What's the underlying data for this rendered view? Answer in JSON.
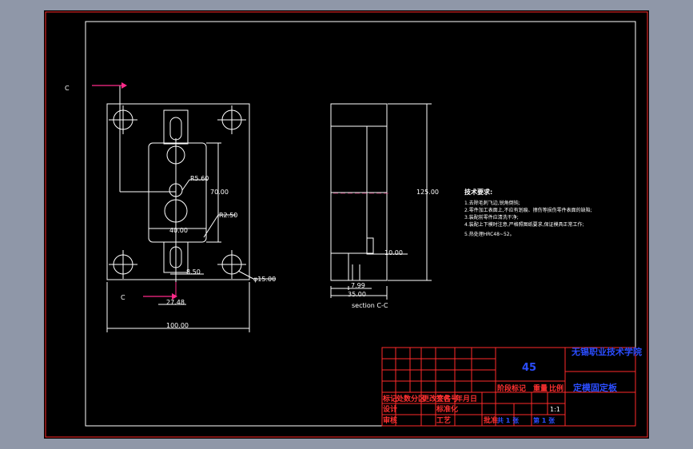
{
  "drawing": {
    "front_view": {
      "section_label_top": "C",
      "section_label_bottom": "C",
      "dims": {
        "r5_60": "R5.60",
        "d70_00": "70.00",
        "r2_50": "R2.50",
        "d40_00": "40.00",
        "d8_50": "8.50",
        "phi15_00": "φ15.00",
        "d27_48": "27.48",
        "d100_00": "100.00"
      }
    },
    "section_view": {
      "dims": {
        "d125_00": "125.00",
        "d10_00": "10.00",
        "d7_99": "7.99",
        "d35_00": "35.00"
      },
      "caption": "section C-C"
    },
    "notes": {
      "title": "技术要求:",
      "lines": [
        "1.去除毛刺飞边,锐角倒钝;",
        "2.零件加工表面上,不应有划痕、擦伤等损伤零件表面的缺陷;",
        "3.装配前零件应清洗干净;",
        "4.装配上下模时注意,严格照图纸要求,保证模具正常工作;",
        "5.热处理HRC48~52。"
      ]
    },
    "title_block": {
      "material": "45",
      "school": "无锡职业技术学院",
      "part_name": "定模固定板",
      "cells": {
        "c1": "标记",
        "c2": "处数",
        "c3": "分区",
        "c4": "更改文件号",
        "c5": "签名",
        "c6": "年月日",
        "c7": "设计",
        "c8": "标准化",
        "c9": "阶段标记",
        "c10": "重量",
        "c11": "比例",
        "c12": "审核",
        "c13": "工艺",
        "c14": "批准",
        "c15": "共 1 张",
        "c16": "第 1 张",
        "c17": "1:1"
      }
    }
  },
  "colors": {
    "background": "#8f97a8",
    "drawing_bg": "#000000",
    "lines": "#ffffff",
    "title_block_lines": "#ff2a2a",
    "blue_text": "#2b4dff",
    "arrow": "#ff2a8a"
  }
}
